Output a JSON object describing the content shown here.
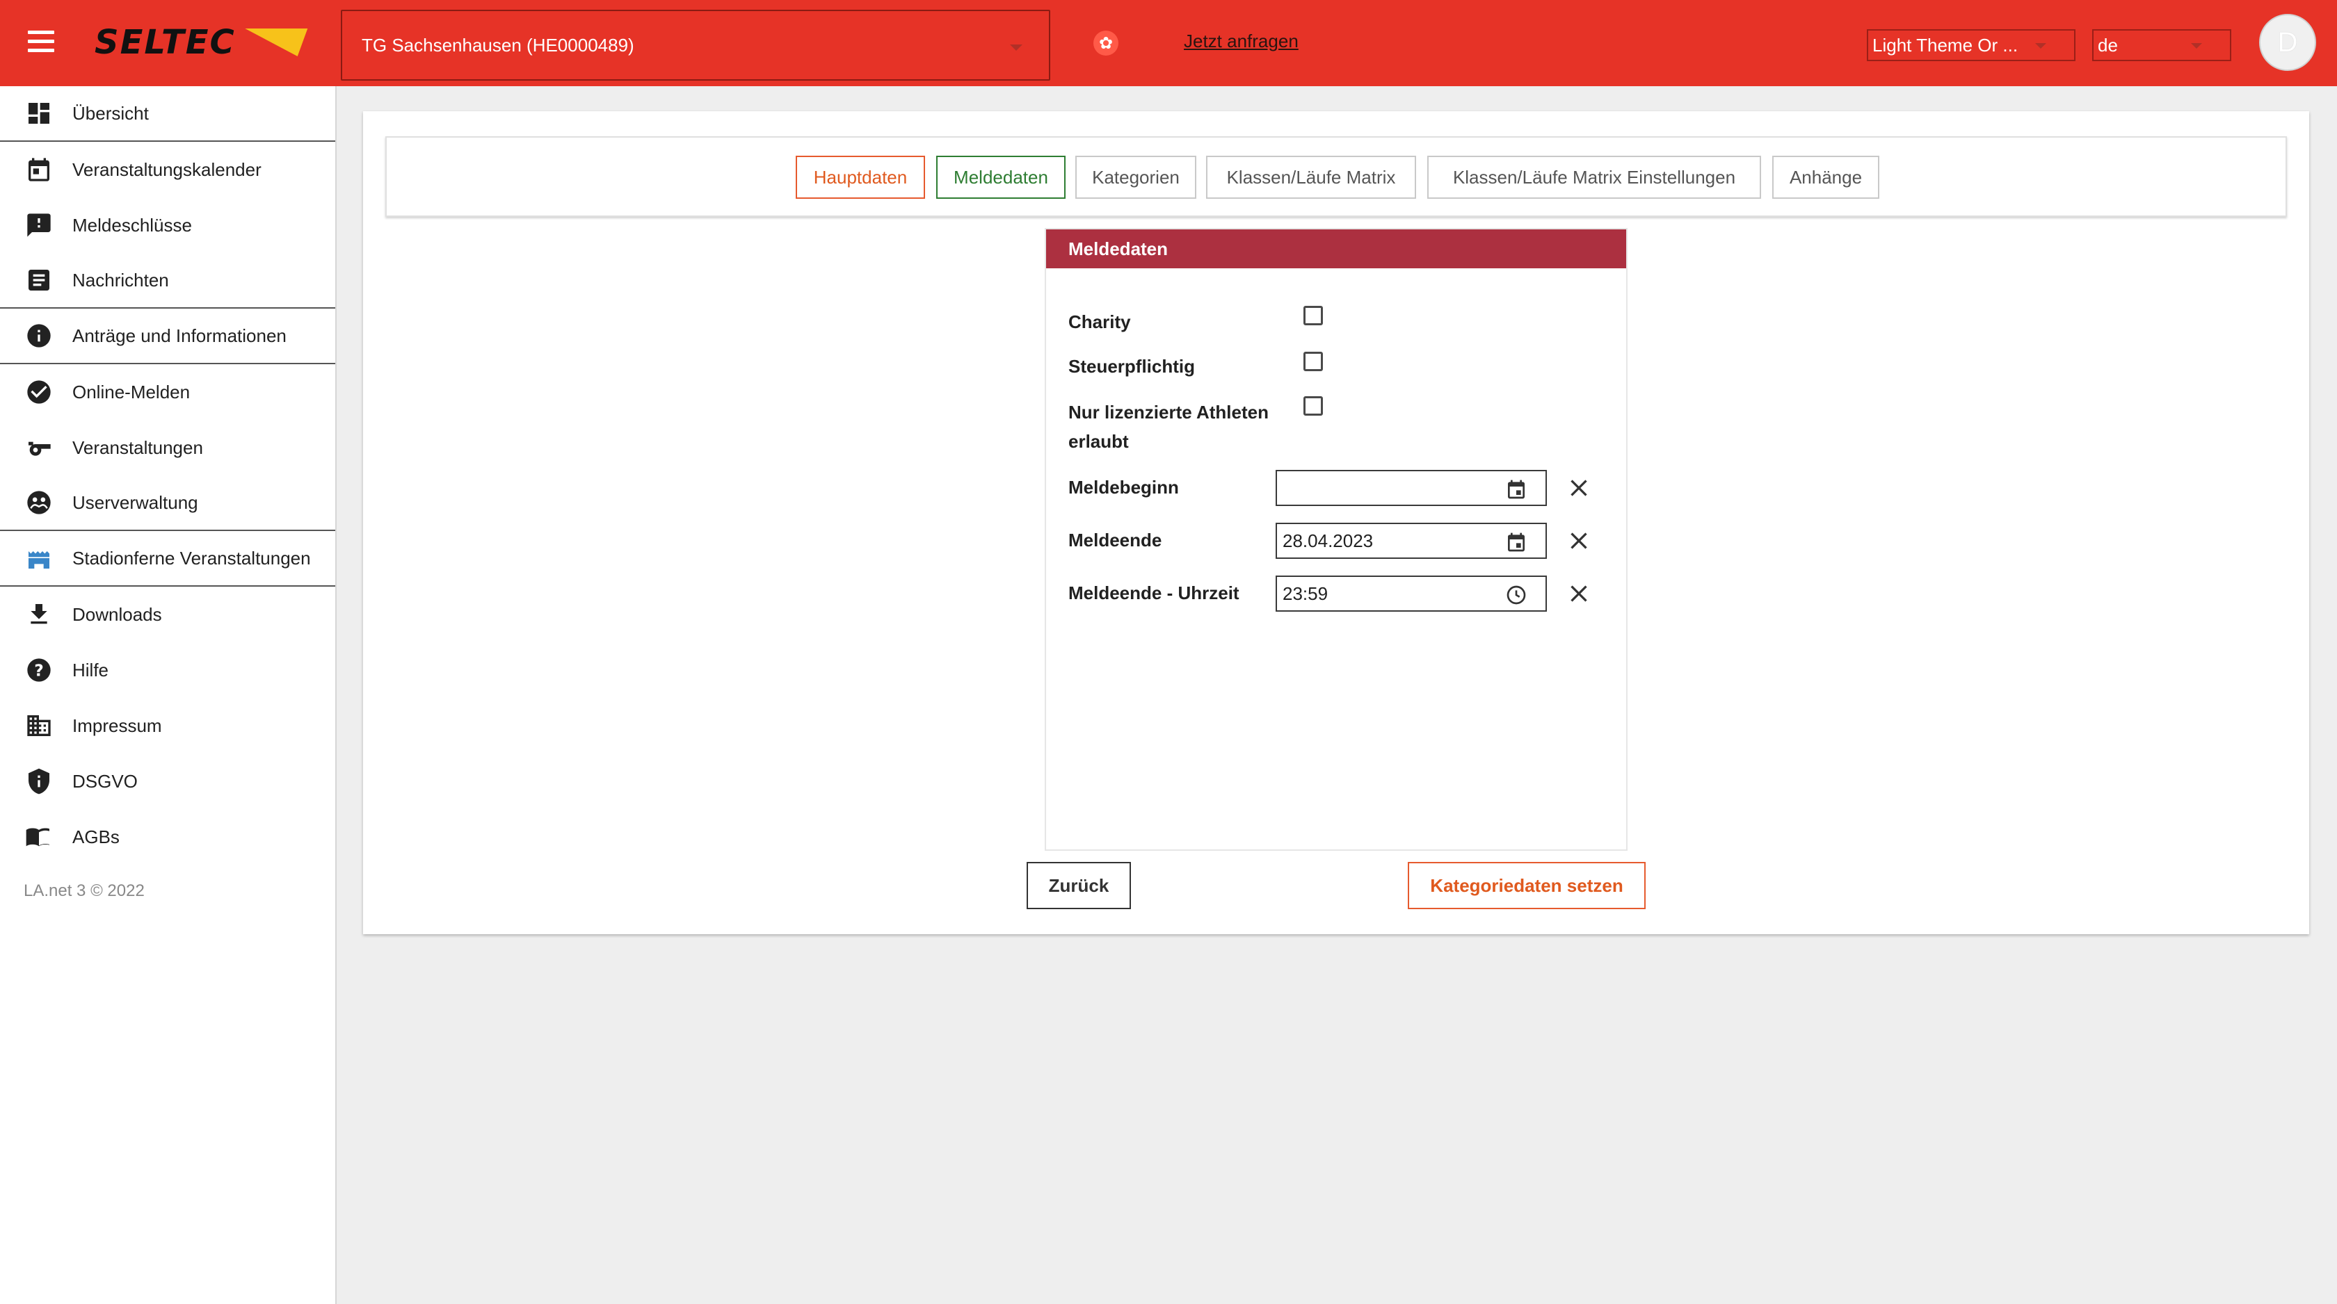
{
  "header": {
    "logo_text": "SELTEC",
    "club_select": "TG Sachsenhausen (HE0000489)",
    "request_link": "Jetzt anfragen",
    "theme_select": "Light Theme Or ...",
    "language_select": "de",
    "avatar_initial": "D",
    "accent_color": "#e63327"
  },
  "sidebar": {
    "items": [
      {
        "label": "Übersicht",
        "icon": "dashboard-icon"
      },
      {
        "label": "Veranstaltungskalender",
        "icon": "calendar-icon"
      },
      {
        "label": "Meldeschlüsse",
        "icon": "alert-comment-icon"
      },
      {
        "label": "Nachrichten",
        "icon": "article-icon"
      },
      {
        "label": "Anträge und Informationen",
        "icon": "info-icon"
      },
      {
        "label": "Online-Melden",
        "icon": "check-circle-icon"
      },
      {
        "label": "Veranstaltungen",
        "icon": "whistle-icon"
      },
      {
        "label": "Userverwaltung",
        "icon": "users-icon"
      },
      {
        "label": "Stadionferne Veranstaltungen",
        "icon": "stadium-icon"
      },
      {
        "label": "Downloads",
        "icon": "download-icon"
      },
      {
        "label": "Hilfe",
        "icon": "help-icon"
      },
      {
        "label": "Impressum",
        "icon": "building-icon"
      },
      {
        "label": "DSGVO",
        "icon": "shield-icon"
      },
      {
        "label": "AGBs",
        "icon": "book-icon"
      }
    ],
    "footer": "LA.net 3 © 2022"
  },
  "tabs": [
    {
      "label": "Hauptdaten",
      "state": "orange"
    },
    {
      "label": "Meldedaten",
      "state": "green"
    },
    {
      "label": "Kategorien",
      "state": "default"
    },
    {
      "label": "Klassen/Läufe Matrix",
      "state": "default"
    },
    {
      "label": "Klassen/Läufe Matrix Einstellungen",
      "state": "default"
    },
    {
      "label": "Anhänge",
      "state": "default"
    }
  ],
  "panel": {
    "title": "Meldedaten",
    "charity_label": "Charity",
    "charity_checked": false,
    "tax_label": "Steuerpflichtig",
    "tax_checked": false,
    "licensed_label_line1": "Nur lizenzierte Athleten",
    "licensed_label_line2": "erlaubt",
    "licensed_checked": false,
    "start_label": "Meldebeginn",
    "start_value": "",
    "end_label": "Meldeende",
    "end_value": "28.04.2023",
    "end_time_label": "Meldeende - Uhrzeit",
    "end_time_value": "23:59"
  },
  "buttons": {
    "back": "Zurück",
    "next": "Kategoriedaten setzen"
  }
}
